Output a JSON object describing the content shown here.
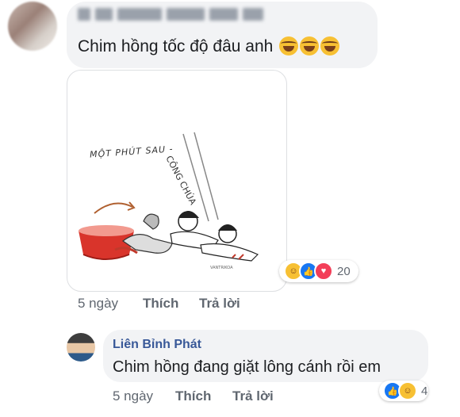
{
  "comment1": {
    "text": "Chim hồng tốc độ đâu anh",
    "emoji_icons": [
      "laugh-cry-icon",
      "laugh-cry-icon",
      "laugh-cry-icon"
    ],
    "image": {
      "caption": "MỘT PHÚT SAU -",
      "vertical_text": "CÔNG CHÚA",
      "signature": "VANTRIKOA"
    },
    "reactions": {
      "icons": [
        "haha-reaction-icon",
        "like-reaction-icon",
        "love-reaction-icon"
      ],
      "count": "20"
    },
    "actions": {
      "time": "5 ngày",
      "like_label": "Thích",
      "reply_label": "Trả lời"
    }
  },
  "comment2": {
    "author": "Liên Bỉnh Phát",
    "text": "Chim hồng đang giặt lông cánh rồi em",
    "reactions": {
      "icons": [
        "like-reaction-icon",
        "haha-reaction-icon"
      ],
      "count": "4"
    },
    "actions": {
      "time": "5 ngày",
      "like_label": "Thích",
      "reply_label": "Trả lời"
    }
  },
  "colors": {
    "bubble_bg": "#f2f3f5",
    "author_link": "#385898",
    "meta_text": "#606770",
    "like_blue": "#1877f2",
    "love_red": "#f33e58",
    "haha_yellow": "#f7c033"
  }
}
